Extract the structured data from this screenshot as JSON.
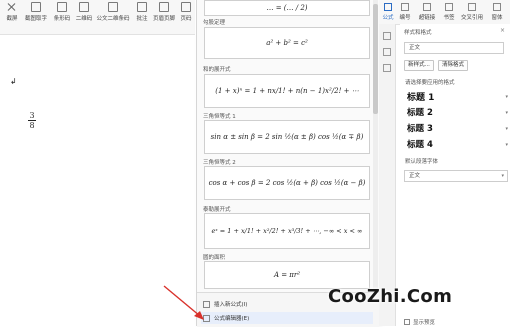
{
  "ribbon": {
    "buttons": [
      {
        "label": "截屏",
        "icon": "scissors-icon"
      },
      {
        "label": "截图取字",
        "icon": "screenshot-text-icon"
      },
      {
        "label": "条形码",
        "icon": "barcode-icon"
      },
      {
        "label": "二维码",
        "icon": "qrcode-icon"
      },
      {
        "label": "公文二维条码",
        "icon": "doc-qrcode-icon"
      },
      {
        "label": "批注",
        "icon": "comment-icon"
      },
      {
        "label": "页眉页脚",
        "icon": "header-footer-icon"
      },
      {
        "label": "页码",
        "icon": "page-number-icon"
      }
    ]
  },
  "document": {
    "fraction_numerator": "3",
    "fraction_denominator": "8"
  },
  "formula_panel": {
    "items": [
      {
        "title": "",
        "formula": "… = (… / 2)"
      },
      {
        "title": "勾股定理",
        "formula": "a² + b² = c²"
      },
      {
        "title": "和的展开式",
        "formula": "(1 + x)ⁿ = 1 + nx/1! + n(n − 1)x²/2! + ⋯"
      },
      {
        "title": "三角恒等式 1",
        "formula": "sin α ± sin β = 2 sin ½(α ± β) cos ½(α ∓ β)"
      },
      {
        "title": "三角恒等式 2",
        "formula": "cos α + cos β = 2 cos ½(α + β) cos ½(α − β)"
      },
      {
        "title": "泰勒展开式",
        "formula": "eˣ = 1 + x/1! + x²/2! + x³/3! + ⋯,   −∞ < x < ∞"
      },
      {
        "title": "圆的面积",
        "formula": "A = πr²"
      }
    ],
    "menu": {
      "insert_new": "插入新公式(I)",
      "editor": "公式编辑器(E)"
    }
  },
  "right_ribbon": {
    "tabs": [
      {
        "label": "公式",
        "active": true
      },
      {
        "label": "编号",
        "active": false
      },
      {
        "label": "超链接",
        "active": false
      },
      {
        "label": "书签",
        "active": false
      },
      {
        "label": "交叉引用",
        "active": false
      },
      {
        "label": "窗体",
        "active": false
      }
    ]
  },
  "style_pane": {
    "title": "样式和格式",
    "close": "×",
    "current_style": "正文",
    "new_style_button": "新样式...",
    "clear_format_button": "清除格式",
    "apply_label": "请选择要应用的格式",
    "styles": [
      "标题 1",
      "标题 2",
      "标题 3",
      "标题 4"
    ],
    "default_font_label": "默认段落字体",
    "default_font_value": "正文",
    "show_preview": "显示预览"
  },
  "watermark": "CooZhi.Com",
  "colors": {
    "accent": "#2b6cc4",
    "arrow": "#d9312b"
  }
}
